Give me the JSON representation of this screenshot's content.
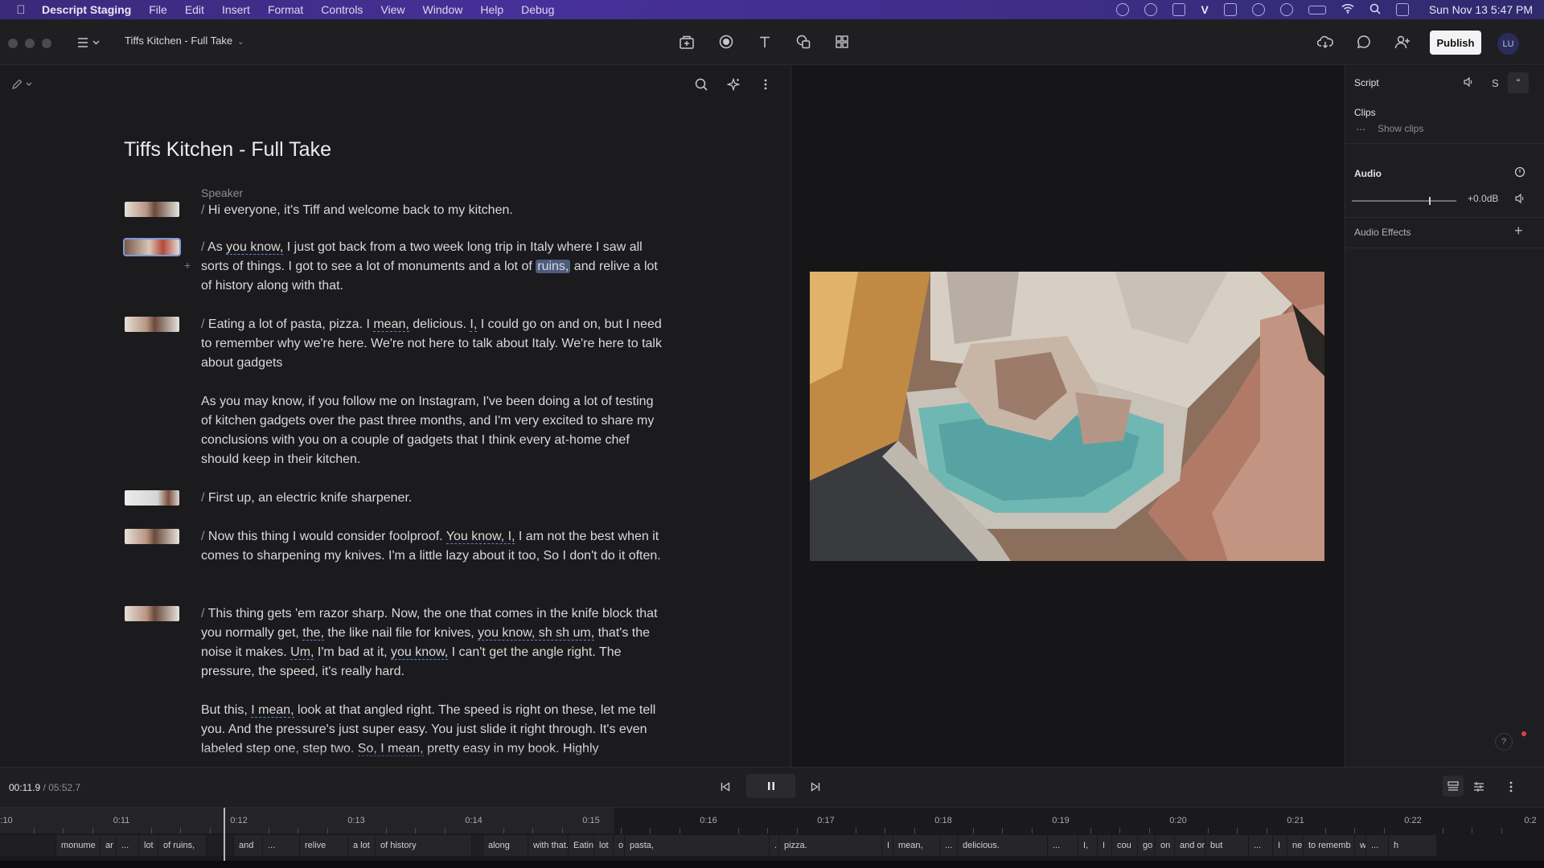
{
  "menubar": {
    "app_name": "Descript Staging",
    "items": [
      "File",
      "Edit",
      "Insert",
      "Format",
      "Controls",
      "View",
      "Window",
      "Help",
      "Debug"
    ],
    "clock": "Sun Nov 13  5:47 PM"
  },
  "toolbar": {
    "document_title": "Tiffs Kitchen - Full Take",
    "publish_label": "Publish",
    "avatar_initials": "LU"
  },
  "script": {
    "title": "Tiffs Kitchen - Full Take",
    "speaker_label": "Speaker",
    "p1": "Hi everyone, it's Tiff and welcome back to my kitchen.",
    "p2": {
      "a": "As ",
      "f1": "you know,",
      "b": " I just got back from a two week long trip in Italy where I saw all sorts of things. I got to see a lot of monuments and a lot of ",
      "hl": "ruins,",
      "c": " and relive a lot of history along with that."
    },
    "p3": {
      "a": "Eating a lot of pasta, pizza. I ",
      "f1": "mean,",
      "b": " delicious. ",
      "f2": "I,",
      "c": " I could go on and on, but I need to remember why we're here. We're not here to talk about Italy. We're here to talk about gadgets"
    },
    "p4": "As you may know, if you follow me on Instagram, I've been doing a lot of testing of kitchen gadgets over the past three months, and I'm very excited to share my conclusions with you on a couple of gadgets that I think every at-home chef should keep in their kitchen.",
    "p5": "First up, an electric knife sharpener.",
    "p6": {
      "a": "Now this thing I would consider foolproof. ",
      "f1": "You know, I,",
      "b": " I am not the best when it comes to sharpening my knives. I'm a little lazy about it too, So I don't do it often."
    },
    "p7": {
      "a": "This thing gets 'em razor sharp. Now, the one that comes in the knife block that you normally get, ",
      "f1": "the,",
      "b": " the like nail file for knives, ",
      "f2": "you know, sh sh um,",
      "c": " that's the noise it makes. ",
      "f3": "Um,",
      "d": " I'm bad at it, ",
      "f4": "you know,",
      "e": " I can't get the angle right. The pressure, the speed, it's really hard."
    },
    "p8": {
      "a": "But this, ",
      "f1": "I mean,",
      "b": " look at that angled right. The speed is right on these, let me tell you. And the pressure's just super easy. You just slide it right through. It's even labeled step one, step two. ",
      "f2": "So, I mean,",
      "c": " pretty easy in my book. Highly"
    }
  },
  "properties": {
    "tab_label": "Script",
    "s_label": "S",
    "clips_label": "Clips",
    "show_clips": "Show clips",
    "audio_label": "Audio",
    "gain_value": "+0.0dB",
    "audio_effects_label": "Audio Effects"
  },
  "transport": {
    "current_time": "00:11.9",
    "separator": "/",
    "total_time": "05:52.7"
  },
  "timeline": {
    "ruler": [
      "0:10",
      "0:11",
      "0:12",
      "0:13",
      "0:14",
      "0:15",
      "0:16",
      "0:17",
      "0:18",
      "0:19",
      "0:20",
      "0:21",
      "0:22",
      "0:2"
    ],
    "words": [
      "",
      "monume",
      "ar",
      "...",
      "lot",
      "of ruins,",
      "",
      "and",
      "...",
      "relive",
      "a lot",
      "of history",
      "",
      "along",
      "with that.",
      "Eatin",
      "lot",
      "o",
      "pasta,",
      ".",
      "pizza.",
      "I",
      "mean,",
      "...",
      "delicious.",
      "...",
      "I,",
      "I",
      "cou",
      "go",
      "on",
      "and on",
      "but",
      "...",
      "I",
      "ne",
      "to rememb",
      "w",
      "...",
      "h"
    ]
  }
}
